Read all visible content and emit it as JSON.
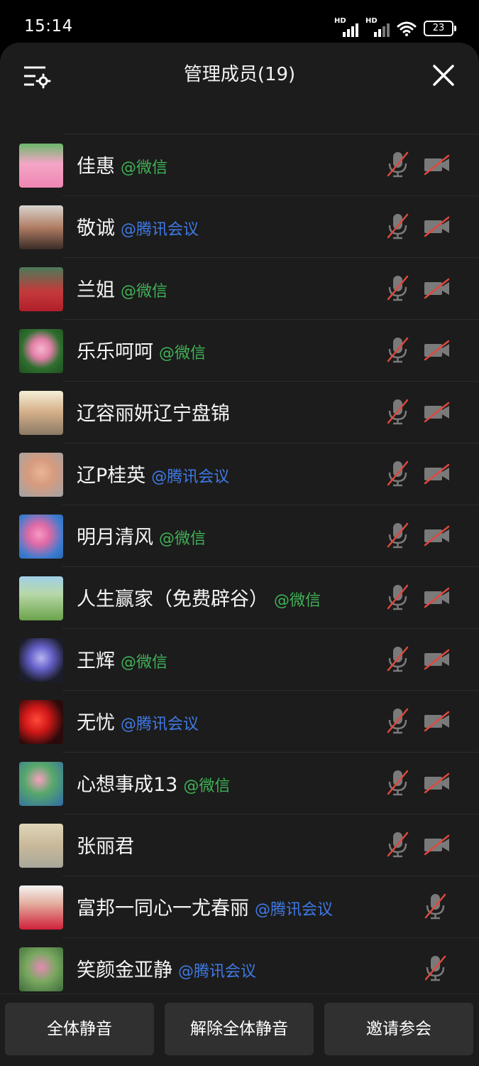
{
  "status_bar": {
    "time": "15:14",
    "signal1_label": "HD",
    "signal2_label": "HD",
    "battery": "23"
  },
  "header": {
    "title": "管理成员(19)"
  },
  "colors": {
    "wechat": "#3fb256",
    "tencent": "#3f7ae6",
    "muted_red": "#e0483e"
  },
  "members": [
    {
      "name": "佳惠",
      "source": "@微信",
      "source_type": "wechat",
      "mic": "muted",
      "camera": "off",
      "avatar": "pink-bear"
    },
    {
      "name": "敬诚",
      "source": "@腾讯会议",
      "source_type": "tencent",
      "mic": "muted",
      "camera": "off",
      "avatar": "man-thumbs-up"
    },
    {
      "name": "兰姐",
      "source": "@微信",
      "source_type": "wechat",
      "mic": "muted",
      "camera": "off",
      "avatar": "woman-red"
    },
    {
      "name": "乐乐呵呵",
      "source": "@微信",
      "source_type": "wechat",
      "mic": "muted",
      "camera": "off",
      "avatar": "lotus"
    },
    {
      "name": "辽容丽妍辽宁盘锦",
      "source": "",
      "source_type": "",
      "mic": "muted",
      "camera": "off",
      "avatar": "woman-portrait"
    },
    {
      "name": "辽P桂英",
      "source": "@腾讯会议",
      "source_type": "tencent",
      "mic": "muted",
      "camera": "off",
      "avatar": "woman-face"
    },
    {
      "name": "明月清风",
      "source": "@微信",
      "source_type": "wechat",
      "mic": "muted",
      "camera": "off",
      "avatar": "peach-blossom"
    },
    {
      "name": "人生赢家（免费辟谷）",
      "source": "@微信",
      "source_type": "wechat",
      "mic": "muted",
      "camera": "off",
      "avatar": "dandelion"
    },
    {
      "name": "王辉",
      "source": "@微信",
      "source_type": "wechat",
      "mic": "muted",
      "camera": "off",
      "avatar": "purple-flowers"
    },
    {
      "name": "无忧",
      "source": "@腾讯会议",
      "source_type": "tencent",
      "mic": "muted",
      "camera": "off",
      "avatar": "lanterns"
    },
    {
      "name": "心想事成13",
      "source": "@微信",
      "source_type": "wechat",
      "mic": "muted",
      "camera": "off",
      "avatar": "lotus-pond"
    },
    {
      "name": "张丽君",
      "source": "",
      "source_type": "",
      "mic": "muted",
      "camera": "off",
      "avatar": "cartoon-girl"
    },
    {
      "name": "富邦一同心一尤春丽",
      "source": "@腾讯会议",
      "source_type": "tencent",
      "mic": "muted",
      "camera": "none",
      "avatar": "woman-red-jacket"
    },
    {
      "name": "笑颜金亚静",
      "source": "@腾讯会议",
      "source_type": "tencent",
      "mic": "muted",
      "camera": "none",
      "avatar": "garden-woman"
    }
  ],
  "footer": {
    "mute_all": "全体静音",
    "unmute_all": "解除全体静音",
    "invite": "邀请参会"
  }
}
